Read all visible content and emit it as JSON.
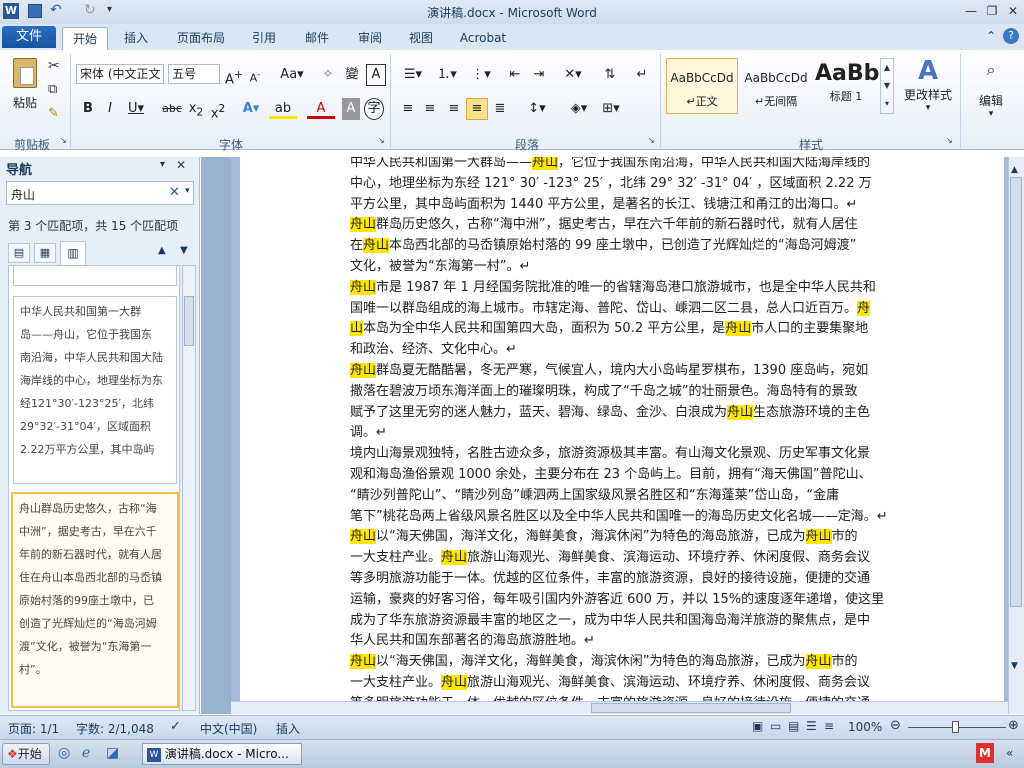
{
  "window": {
    "title": "演讲稿.docx - Microsoft Word",
    "logo": "W"
  },
  "tabs": {
    "file": "文件",
    "items": [
      "开始",
      "插入",
      "页面布局",
      "引用",
      "邮件",
      "审阅",
      "视图",
      "Acrobat"
    ]
  },
  "ribbon": {
    "clipboard": {
      "paste": "粘贴",
      "label": "剪贴板"
    },
    "font": {
      "name": "宋体 (中文正文",
      "size": "五号",
      "label": "字体"
    },
    "paragraph": {
      "label": "段落"
    },
    "styles": {
      "label": "样式",
      "items": [
        {
          "preview": "AaBbCcDd",
          "name": "↵正文"
        },
        {
          "preview": "AaBbCcDd",
          "name": "↵无间隔"
        },
        {
          "preview": "AaBb",
          "name": "标题 1"
        }
      ],
      "change": "更改样式"
    },
    "editing": {
      "label": "编辑"
    }
  },
  "nav": {
    "title": "导航",
    "search": "舟山",
    "match": "第 3 个匹配项，共 15 个匹配项",
    "snippets": [
      [
        "中华人民共和国第一大群",
        "岛——舟山，它位于我国东",
        "南沿海，中华人民共和国大陆",
        "海岸线的中心，地理坐标为东",
        "经121°30′-123°25′，北纬",
        "29°32′-31°04′，区域面积",
        "2.22万平方公里，其中岛屿"
      ],
      [
        "舟山群岛历史悠久，古称“海",
        "中洲”，据史考古，早在六千",
        "年前的新石器时代，就有人居",
        "住在舟山本岛西北部的马岙镇",
        "原始村落的99座土墩中，已",
        "创造了光辉灿烂的“海岛河姆",
        "渡”文化，被誉为“东海第一",
        "村”。"
      ]
    ]
  },
  "document": {
    "lines": [
      [
        [
          "中华人民共和国第一大群岛——",
          ""
        ],
        [
          "舟山",
          "hl"
        ],
        [
          "，它位于我国东南沿海，中华人民共和国大陆海岸线的",
          ""
        ]
      ],
      [
        [
          "中心，地理坐标为东经 121° 30′ -123° 25′ ，北纬 29° 32′ -31° 04′ ，区域面积 2.22 万",
          ""
        ]
      ],
      [
        [
          "平方公里，其中岛屿面积为 1440 平方公里，是著名的长江、钱塘江和甬江的出海口。↵",
          ""
        ]
      ],
      [
        [
          "舟山",
          "hl"
        ],
        [
          "群岛历史悠久，古称“海中洲”，据史考古，早在六千年前的新石器时代，就有人居住",
          ""
        ]
      ],
      [
        [
          "在",
          ""
        ],
        [
          "舟山",
          "hl"
        ],
        [
          "本岛西北部的马岙镇原始村落的 99 座土墩中，已创造了光辉灿烂的“海岛河姆渡”",
          ""
        ]
      ],
      [
        [
          "文化，被誉为“东海第一村”。↵",
          ""
        ]
      ],
      [
        [
          "舟山",
          "hl"
        ],
        [
          "市是 1987 年 1 月经国务院批准的唯一的省辖海岛港口旅游城市，也是全中华人民共和",
          ""
        ]
      ],
      [
        [
          "国唯一以群岛组成的海上城市。市辖定海、普陀、岱山、嵊泗二区二县，总人口近百万。",
          ""
        ],
        [
          "舟",
          "hl"
        ]
      ],
      [
        [
          "山",
          "hl"
        ],
        [
          "本岛为全中华人民共和国第四大岛，面积为 50.2 平方公里，是",
          ""
        ],
        [
          "舟山",
          "hl"
        ],
        [
          "市人口的主要集聚地",
          ""
        ]
      ],
      [
        [
          "和政治、经济、文化中心。↵",
          ""
        ]
      ],
      [
        [
          "舟山",
          "hl"
        ],
        [
          "群岛夏无酷酷暑，冬无严寒，气候宜人，境内大小岛屿星罗棋布，1390 座岛屿，宛如",
          ""
        ]
      ],
      [
        [
          "撒落在碧波万顷东海洋面上的璀璨明珠，构成了“千岛之城”的壮丽景色。海岛特有的景致",
          ""
        ]
      ],
      [
        [
          "赋予了这里无穷的迷人魅力，蓝天、碧海、绿岛、金沙、白浪成为",
          ""
        ],
        [
          "舟山",
          "hl"
        ],
        [
          "生态旅游环境的主色",
          ""
        ]
      ],
      [
        [
          "调。↵",
          ""
        ]
      ],
      [
        [
          "境内山海景观独特，名胜古迹众多，旅游资源极其丰富。有山海文化景观、历史军事文化景",
          ""
        ]
      ],
      [
        [
          "观和海岛渔俗景观 1000 余处，主要分布在 23 个岛屿上。目前，拥有“海天佛国”普陀山、",
          ""
        ]
      ],
      [
        [
          "“睛沙列普陀山”、“睛沙列岛”嵊泗两上国家级风景名胜区和“东海蓬莱”岱山岛，“金庸",
          ""
        ]
      ],
      [
        [
          "笔下”桃花岛两上省级风景名胜区以及全中华人民共和国唯一的海岛历史文化名城——定海。↵",
          ""
        ]
      ],
      [
        [
          "舟山",
          "hl"
        ],
        [
          "以“海天佛国，海洋文化，海鲜美食，海滨休闲”为特色的海岛旅游，已成为",
          ""
        ],
        [
          "舟山",
          "hl"
        ],
        [
          "市的",
          ""
        ]
      ],
      [
        [
          "一大支柱产业。",
          ""
        ],
        [
          "舟山",
          "hl"
        ],
        [
          "旅游山海观光、海鲜美食、滨海运动、环境疗养、休闲度假、商务会议",
          ""
        ]
      ],
      [
        [
          "等多明旅游功能于一体。优越的区位条件，丰富的旅游资源，良好的接待设施，便捷的交通",
          ""
        ]
      ],
      [
        [
          "运输，豪爽的好客习俗，每年吸引国内外游客近 600 万，并以 15%的速度逐年递增，使这里",
          ""
        ]
      ],
      [
        [
          "成为了华东旅游资源最丰富的地区之一，成为中华人民共和国海岛海洋旅游的聚焦点，是中",
          ""
        ]
      ],
      [
        [
          "华人民共和国东部著名的海岛旅游胜地。↵",
          ""
        ]
      ],
      [
        [
          "舟山",
          "hl"
        ],
        [
          "以“海天佛国，海洋文化，海鲜美食，海滨休闲”为特色的海岛旅游，已成为",
          ""
        ],
        [
          "舟山",
          "hl"
        ],
        [
          "市的",
          ""
        ]
      ],
      [
        [
          "一大支柱产业。",
          ""
        ],
        [
          "舟山",
          "hl"
        ],
        [
          "旅游山海观光、海鲜美食、滨海运动、环境疗养、休闲度假、商务会议",
          ""
        ]
      ],
      [
        [
          "等多明旅游功能于一体。优越的区位条件，丰富的旅游资源，良好的接待设施，便捷的交通",
          ""
        ]
      ]
    ]
  },
  "status": {
    "page": "页面: 1/1",
    "words": "字数: 2/1,048",
    "lang": "中文(中国)",
    "mode": "插入",
    "zoom": "100%"
  },
  "taskbar": {
    "start": "开始",
    "window": "演讲稿.docx - Micro..."
  }
}
